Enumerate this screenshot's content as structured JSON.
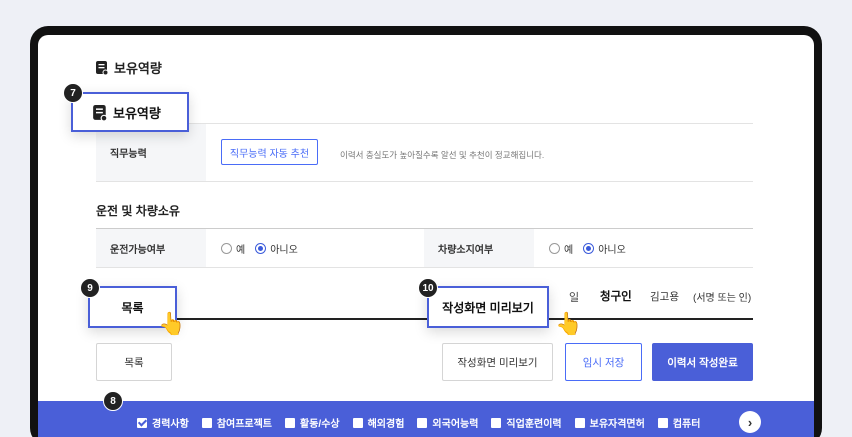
{
  "capability": {
    "section_title": "보유역량",
    "callout_label": "보유역량",
    "callout_badge": "7",
    "row_label": "직무능력",
    "auto_button": "직무능력 자동 추천",
    "hint": "이력서 충실도가 높아질수록 알선 및 추천이 정교해집니다."
  },
  "driving": {
    "section_title": "운전 및 차량소유",
    "license_label": "운전가능여부",
    "vehicle_label": "차량소지여부",
    "yes": "예",
    "no": "아니오"
  },
  "sign_row": {
    "partial_day": "일",
    "claimant": "청구인",
    "name": "김고용",
    "sign_hint": "(서명 또는 인)"
  },
  "callouts": {
    "list": {
      "badge": "9",
      "label": "목록"
    },
    "preview": {
      "badge": "10",
      "label": "작성화면 미리보기"
    },
    "tabs": {
      "badge": "8"
    }
  },
  "actions": {
    "list": "목록",
    "preview": "작성화면 미리보기",
    "temp_save": "임시 저장",
    "complete": "이력서 작성완료"
  },
  "tab_bar": {
    "items": [
      {
        "label": "경력사항",
        "checked": true
      },
      {
        "label": "참여프로젝트",
        "checked": false
      },
      {
        "label": "활동/수상",
        "checked": false
      },
      {
        "label": "해외경험",
        "checked": false
      },
      {
        "label": "외국어능력",
        "checked": false
      },
      {
        "label": "직업훈련이력",
        "checked": false
      },
      {
        "label": "보유자격면허",
        "checked": false
      },
      {
        "label": "컴퓨터",
        "checked": false
      }
    ],
    "next_icon": "chevron-right-icon"
  },
  "colors": {
    "accent": "#4a5fd8",
    "frame": "#111111",
    "background": "#eef0f6"
  }
}
